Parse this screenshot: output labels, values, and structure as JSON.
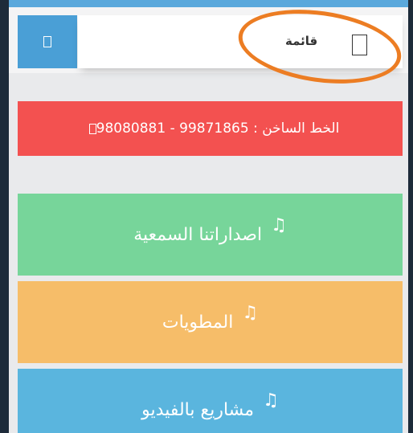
{
  "header": {
    "menu_label": "قائمة"
  },
  "hotline": {
    "text": "الخط الساخن : 99871865 - 98080881"
  },
  "tiles": [
    {
      "label": "اصداراتنا السمعية",
      "icon": "music-note-icon",
      "color": "#77d59a"
    },
    {
      "label": "المطويات",
      "icon": "music-note-icon",
      "color": "#f6bd69"
    },
    {
      "label": "مشاريع بالفيديو",
      "icon": "music-note-icon",
      "color": "#5ab5de"
    }
  ],
  "colors": {
    "accent_blue": "#4a9fd6",
    "hotline_red": "#f35150",
    "annotation_orange": "#ec7d23"
  }
}
